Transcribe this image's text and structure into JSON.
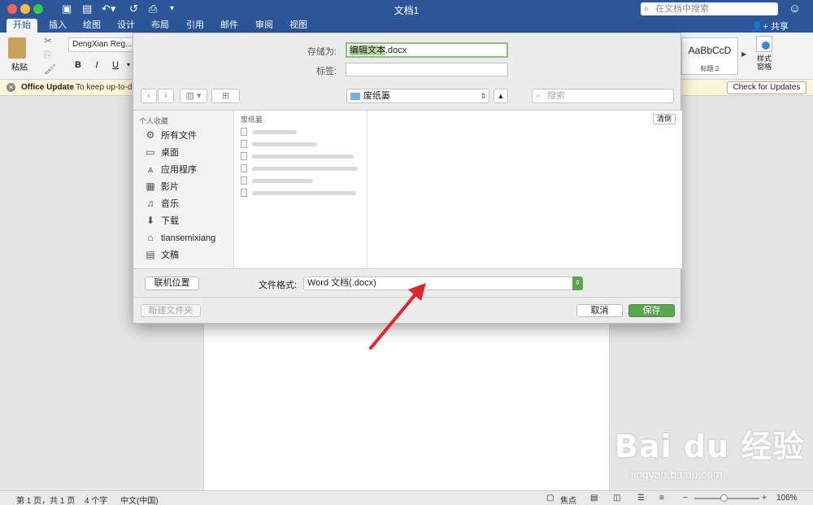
{
  "window": {
    "title": "文档1",
    "search_placeholder": "在文档中搜索"
  },
  "ribbon": {
    "tabs": [
      "开始",
      "插入",
      "绘图",
      "设计",
      "布局",
      "引用",
      "邮件",
      "审阅",
      "视图"
    ],
    "share_label": "共享",
    "paste_label": "粘贴",
    "font_name": "DengXian Reg...",
    "bold": "B",
    "italic": "I",
    "underline": "U",
    "style_sample": "AaBbCcD",
    "style_name": "标题 2",
    "style_pane_label": "样式\n窗格"
  },
  "update_bar": {
    "title": "Office Update",
    "message": "To keep up-to-d",
    "button": "Check for Updates"
  },
  "dialog": {
    "save_as_label": "存储为:",
    "file_name_selected": "编辑文本",
    "file_name_ext": ".docx",
    "tags_label": "标签:",
    "tags_value": "",
    "location": "废纸篓",
    "search_placeholder": "搜索",
    "sidebar_heading": "个人收藏",
    "sidebar_items": [
      {
        "label": "所有文件",
        "icon": "gear-icon"
      },
      {
        "label": "桌面",
        "icon": "desktop-icon"
      },
      {
        "label": "应用程序",
        "icon": "apps-icon"
      },
      {
        "label": "影片",
        "icon": "film-icon"
      },
      {
        "label": "音乐",
        "icon": "music-icon"
      },
      {
        "label": "下载",
        "icon": "download-icon"
      },
      {
        "label": "tiansemixiang",
        "icon": "home-icon"
      },
      {
        "label": "文稿",
        "icon": "documents-icon"
      }
    ],
    "column_heading": "废纸篓",
    "clear_label": "清倒",
    "online_button": "联机位置",
    "format_label": "文件格式:",
    "format_value": "Word 文档(.docx)",
    "new_folder": "新建文件夹",
    "cancel": "取消",
    "save": "保存"
  },
  "statusbar": {
    "page": "第 1 页，共 1 页",
    "words": "4 个字",
    "language": "中文(中国)",
    "focus": "焦点",
    "zoom": "106%"
  },
  "watermark": {
    "main": "Bai du 经验",
    "sub": "jingyan.baidu.com"
  },
  "colors": {
    "accent": "#2b579a",
    "save_green": "#5aa54e",
    "annotation_red": "#e0262b"
  }
}
